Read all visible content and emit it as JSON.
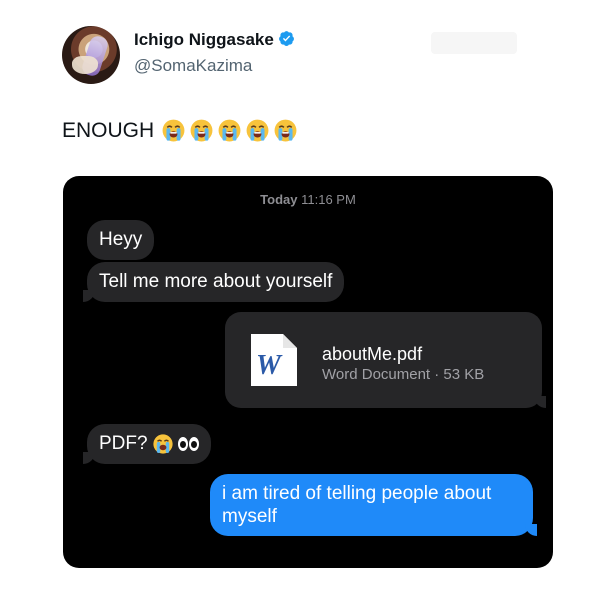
{
  "tweet": {
    "display_name": "Ichigo Niggasake",
    "handle": "@SomaKazima",
    "text": "ENOUGH",
    "emoji_count": 5,
    "emoji_name": "loudly-crying-face"
  },
  "conversation": {
    "timestamp_day": "Today",
    "timestamp_time": "11:16 PM",
    "messages": [
      {
        "from": "them",
        "text": "Heyy"
      },
      {
        "from": "them",
        "text": "Tell me more about yourself"
      },
      {
        "from": "me",
        "type": "attachment",
        "file_name": "aboutMe.pdf",
        "file_meta": "Word Document · 53 KB",
        "icon": "word-document-icon",
        "icon_letter": "W"
      },
      {
        "from": "them",
        "text": "PDF?"
      },
      {
        "from": "me",
        "text": "i am tired of telling people about myself"
      }
    ]
  },
  "colors": {
    "bubble_gray": "#262628",
    "bubble_blue": "#1f8af9",
    "verified_blue": "#1d9bf0",
    "background_dark": "#000000"
  }
}
